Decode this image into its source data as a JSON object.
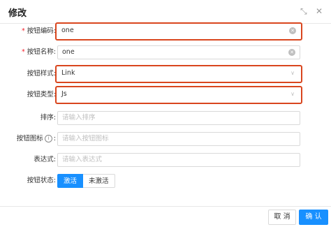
{
  "modal": {
    "title": "修改",
    "fullscreen_icon": "expand-icon",
    "close_icon": "close-icon"
  },
  "form": {
    "button_code": {
      "label": "按钮编码:",
      "required": "*",
      "value": "one"
    },
    "button_name": {
      "label": "按钮名称:",
      "required": "*",
      "value": "one"
    },
    "button_style": {
      "label": "按钮样式:",
      "value": "Link"
    },
    "button_type": {
      "label": "按钮类型:",
      "value": "Js"
    },
    "sort": {
      "label": "排序:",
      "placeholder": "请输入排序"
    },
    "button_icon": {
      "label": "按钮图标",
      "info": "i",
      "colon": ":",
      "placeholder": "请输入按钮图标"
    },
    "expression": {
      "label": "表达式:",
      "placeholder": "请输入表达式"
    },
    "button_status": {
      "label": "按钮状态:",
      "options": [
        "激活",
        "未激活"
      ],
      "selected": "激活"
    }
  },
  "footer": {
    "cancel_label": "取 消",
    "ok_label": "确 认"
  },
  "colors": {
    "primary": "#1890ff",
    "highlight": "#d9461e",
    "required": "#f5222d"
  }
}
